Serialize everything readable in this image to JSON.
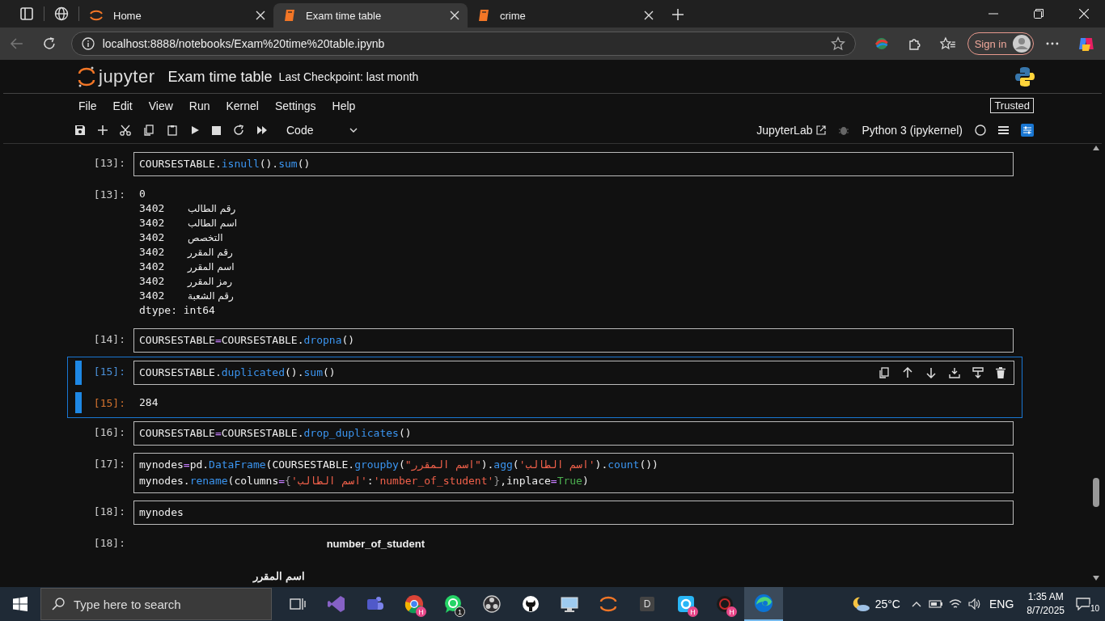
{
  "browser": {
    "tabs": [
      {
        "title": "Home",
        "kind": "jupyter",
        "selected": false
      },
      {
        "title": "Exam time table",
        "kind": "book",
        "selected": true
      },
      {
        "title": "crime",
        "kind": "book",
        "selected": false
      }
    ],
    "url": "localhost:8888/notebooks/Exam%20time%20table.ipynb",
    "sign_in": "Sign in"
  },
  "jupyter": {
    "logo": "jupyter",
    "title": "Exam time table",
    "checkpoint": "Last Checkpoint: last month",
    "menu": [
      "File",
      "Edit",
      "View",
      "Run",
      "Kernel",
      "Settings",
      "Help"
    ],
    "trusted": "Trusted",
    "cell_type": "Code",
    "lab_link": "JupyterLab",
    "kernel": "Python 3 (ipykernel)"
  },
  "cells": [
    {
      "kind": "code",
      "prompt": "[13]:",
      "active": false,
      "lines": [
        [
          {
            "t": "COURSESTABLE.",
            "kind": "plain"
          },
          {
            "t": "isnull",
            "kind": "attr"
          },
          {
            "t": "().",
            "kind": "plain"
          },
          {
            "t": "sum",
            "kind": "attr"
          },
          {
            "t": "()",
            "kind": "plain"
          }
        ]
      ]
    },
    {
      "kind": "series",
      "prompt": "[13]:",
      "active": false,
      "header": "0",
      "rows": [
        {
          "label": "رقم الطالب",
          "value": "3402"
        },
        {
          "label": "اسم الطالب",
          "value": "3402"
        },
        {
          "label": "التخصص",
          "value": "3402"
        },
        {
          "label": "رقم المقرر",
          "value": "3402"
        },
        {
          "label": "اسم المقرر",
          "value": "3402"
        },
        {
          "label": "رمز المقرر",
          "value": "3402"
        },
        {
          "label": "رقم الشعبة",
          "value": "3402"
        }
      ],
      "dtype": "dtype: int64"
    },
    {
      "kind": "code",
      "prompt": "[14]:",
      "active": false,
      "lines": [
        [
          {
            "t": "COURSESTABLE",
            "kind": "plain"
          },
          {
            "t": "=",
            "kind": "op"
          },
          {
            "t": "COURSESTABLE.",
            "kind": "plain"
          },
          {
            "t": "dropna",
            "kind": "attr"
          },
          {
            "t": "()",
            "kind": "plain"
          }
        ]
      ]
    },
    {
      "kind": "code",
      "prompt": "[15]:",
      "active": true,
      "lines": [
        [
          {
            "t": "COURSESTABLE.",
            "kind": "plain"
          },
          {
            "t": "duplicated",
            "kind": "attr"
          },
          {
            "t": "().",
            "kind": "plain"
          },
          {
            "t": "sum",
            "kind": "attr"
          },
          {
            "t": "()",
            "kind": "plain"
          }
        ]
      ]
    },
    {
      "kind": "text",
      "prompt": "[15]:",
      "active": true,
      "text": "284"
    },
    {
      "kind": "code",
      "prompt": "[16]:",
      "active": false,
      "lines": [
        [
          {
            "t": "COURSESTABLE",
            "kind": "plain"
          },
          {
            "t": "=",
            "kind": "op"
          },
          {
            "t": "COURSESTABLE.",
            "kind": "plain"
          },
          {
            "t": "drop_duplicates",
            "kind": "attr"
          },
          {
            "t": "()",
            "kind": "plain"
          }
        ]
      ]
    },
    {
      "kind": "code",
      "prompt": "[17]:",
      "active": false,
      "lines": [
        [
          {
            "t": "mynodes",
            "kind": "plain"
          },
          {
            "t": "=",
            "kind": "op"
          },
          {
            "t": "pd.",
            "kind": "plain"
          },
          {
            "t": "DataFrame",
            "kind": "attr"
          },
          {
            "t": "(COURSESTABLE.",
            "kind": "plain"
          },
          {
            "t": "groupby",
            "kind": "attr"
          },
          {
            "t": "(",
            "kind": "plain"
          },
          {
            "t": "\"اسم المقرر\"",
            "kind": "str"
          },
          {
            "t": ").",
            "kind": "plain"
          },
          {
            "t": "agg",
            "kind": "attr"
          },
          {
            "t": "(",
            "kind": "plain"
          },
          {
            "t": "'اسم الطالب'",
            "kind": "str"
          },
          {
            "t": ").",
            "kind": "plain"
          },
          {
            "t": "count",
            "kind": "attr"
          },
          {
            "t": "())",
            "kind": "plain"
          }
        ],
        [
          {
            "t": "mynodes.",
            "kind": "plain"
          },
          {
            "t": "rename",
            "kind": "attr"
          },
          {
            "t": "(columns",
            "kind": "plain"
          },
          {
            "t": "=",
            "kind": "op"
          },
          {
            "t": "{",
            "kind": "punct"
          },
          {
            "t": "'اسم الطالب'",
            "kind": "str"
          },
          {
            "t": ":",
            "kind": "plain"
          },
          {
            "t": "'number_of_student'",
            "kind": "str"
          },
          {
            "t": "}",
            "kind": "punct"
          },
          {
            "t": ",inplace",
            "kind": "plain"
          },
          {
            "t": "=",
            "kind": "op"
          },
          {
            "t": "True",
            "kind": "kw"
          },
          {
            "t": ")",
            "kind": "plain"
          }
        ]
      ]
    },
    {
      "kind": "code",
      "prompt": "[18]:",
      "active": false,
      "lines": [
        [
          {
            "t": "mynodes",
            "kind": "plain"
          }
        ]
      ]
    },
    {
      "kind": "table",
      "prompt": "[18]:",
      "active": false,
      "column": "number_of_student",
      "index_name": "اسم المقرر"
    }
  ],
  "taskbar": {
    "search_placeholder": "Type here to search",
    "apps": [
      {
        "kind": "taskview",
        "active": false
      },
      {
        "kind": "vs",
        "active": false
      },
      {
        "kind": "teams",
        "active": false
      },
      {
        "kind": "chrome",
        "badge": "H",
        "active": false
      },
      {
        "kind": "whatsapp",
        "badge": "1",
        "active": false
      },
      {
        "kind": "obs",
        "active": false
      },
      {
        "kind": "github",
        "active": false
      },
      {
        "kind": "remote",
        "active": false
      },
      {
        "kind": "jupyter",
        "active": false
      },
      {
        "kind": "letter",
        "letter": "D",
        "active": false
      },
      {
        "kind": "app",
        "badge": "H",
        "active": false
      },
      {
        "kind": "dark",
        "badge": "H",
        "active": false
      },
      {
        "kind": "edge",
        "active": true
      }
    ],
    "temperature": "25°C",
    "language": "ENG",
    "time": "1:35 AM",
    "date": "8/7/2025",
    "notifications": "10"
  }
}
